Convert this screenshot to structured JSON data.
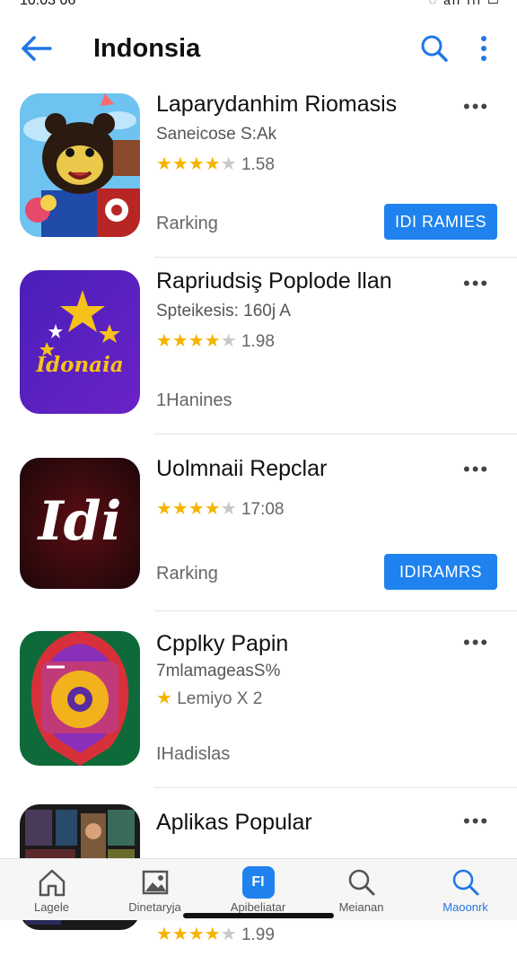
{
  "status": {
    "time": "10:03 06",
    "right": "◌ ail ııl ▭"
  },
  "header": {
    "title": "Indonsia",
    "back_icon": "back-arrow-icon",
    "search_icon": "search-icon",
    "more_icon": "more-vertical-icon",
    "accent": "#1f77e6"
  },
  "apps": [
    {
      "name": "Laparydanhim Riomasis",
      "subtitle": "Saneicose S:Ak",
      "rating": "1.58",
      "rating_stars": 4,
      "meta": "Rarking",
      "action": "IDI RAMIES",
      "icon": "bear-cartoon-icon"
    },
    {
      "name": "Rapriudsiş Poplode llan",
      "subtitle": "Spteikesis: 160j A",
      "rating": "1.98",
      "rating_stars": 4,
      "meta": "1Hanines",
      "action": "",
      "icon": "idonaia-stars-icon",
      "icon_text": "Idonaia"
    },
    {
      "name": "Uolmnaii Repclar",
      "subtitle": "",
      "rating": "17:08",
      "rating_stars": 4,
      "meta": "Rarking",
      "action": "IDIRAMRS",
      "icon": "idi-letter-icon",
      "icon_text": "Idi"
    },
    {
      "name": "Cpplky Papin",
      "subtitle": "7mlamageasS%",
      "rating": "Lemiyo X 2",
      "rating_stars": 1,
      "meta": "IHadislas",
      "action": "",
      "icon": "colorful-disc-icon"
    },
    {
      "name": "Aplikas Popular",
      "subtitle": "",
      "rating": "1.99",
      "rating_stars": 4,
      "meta": "",
      "action": "",
      "icon": "movie-collage-icon"
    }
  ],
  "nav": [
    {
      "label": "Lagele",
      "icon": "home-icon",
      "active": false
    },
    {
      "label": "Dinetaryja",
      "icon": "image-icon",
      "active": false
    },
    {
      "label": "Apibeliatar",
      "icon": "apps-icon",
      "active": false,
      "badge": "FI"
    },
    {
      "label": "Meianan",
      "icon": "search-icon",
      "active": false
    },
    {
      "label": "Maoonrk",
      "icon": "search-icon",
      "active": true
    }
  ]
}
